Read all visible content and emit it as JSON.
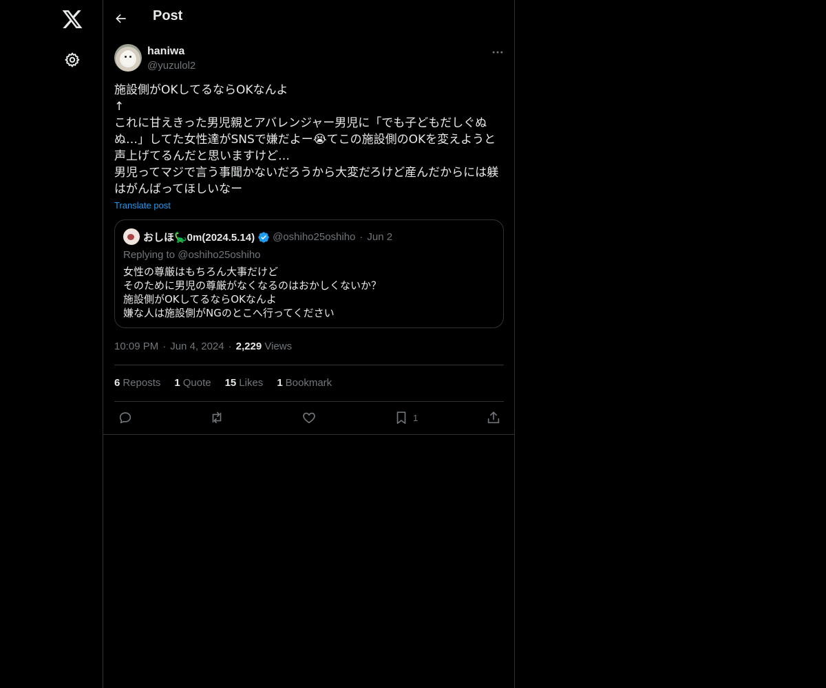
{
  "header": {
    "title": "Post"
  },
  "post": {
    "author": {
      "display_name": "haniwa",
      "handle": "@yuzulol2"
    },
    "text": "施設側がOKしてるならOKなんよ\n↑\nこれに甘えきった男児親とアバレンジャー男児に「でも子どもだしぐぬぬ…」してた女性達がSNSで嫌だよー😭てこの施設側のOKを変えようと声上げてるんだと思いますけど…\n男児ってマジで言う事聞かないだろうから大変だろけど産んだからには躾はがんばってほしいなー",
    "translate_label": "Translate post",
    "quote": {
      "display_name": "おしほ🦕0m(2024.5.14)",
      "handle": "@oshiho25oshiho",
      "separator": "·",
      "date": "Jun 2",
      "replying_to": "Replying to @oshiho25oshiho",
      "text": "女性の尊厳はもちろん大事だけど\nそのために男児の尊厳がなくなるのはおかしくないか？\n施設側がOKしてるならOKなんよ\n嫌な人は施設側がNGのとこへ行ってください"
    },
    "meta": {
      "time": "10:09 PM",
      "date": "Jun 4, 2024",
      "views_count": "2,229",
      "views_label": "Views",
      "separator": "·"
    },
    "stats": {
      "reposts": {
        "count": "6",
        "label": "Reposts"
      },
      "quotes": {
        "count": "1",
        "label": "Quote"
      },
      "likes": {
        "count": "15",
        "label": "Likes"
      },
      "bookmarks": {
        "count": "1",
        "label": "Bookmark"
      }
    },
    "actions": {
      "bookmark_count": "1"
    }
  },
  "icons": [
    "x-logo-icon",
    "gear-icon",
    "back-arrow-icon",
    "more-icon",
    "verified-badge-icon",
    "reply-icon",
    "repost-icon",
    "like-icon",
    "bookmark-icon",
    "share-icon"
  ],
  "colors": {
    "background": "#000000",
    "text": "#e7e9ea",
    "muted": "#71767b",
    "link": "#1d9bf0",
    "border": "#2f3336"
  }
}
